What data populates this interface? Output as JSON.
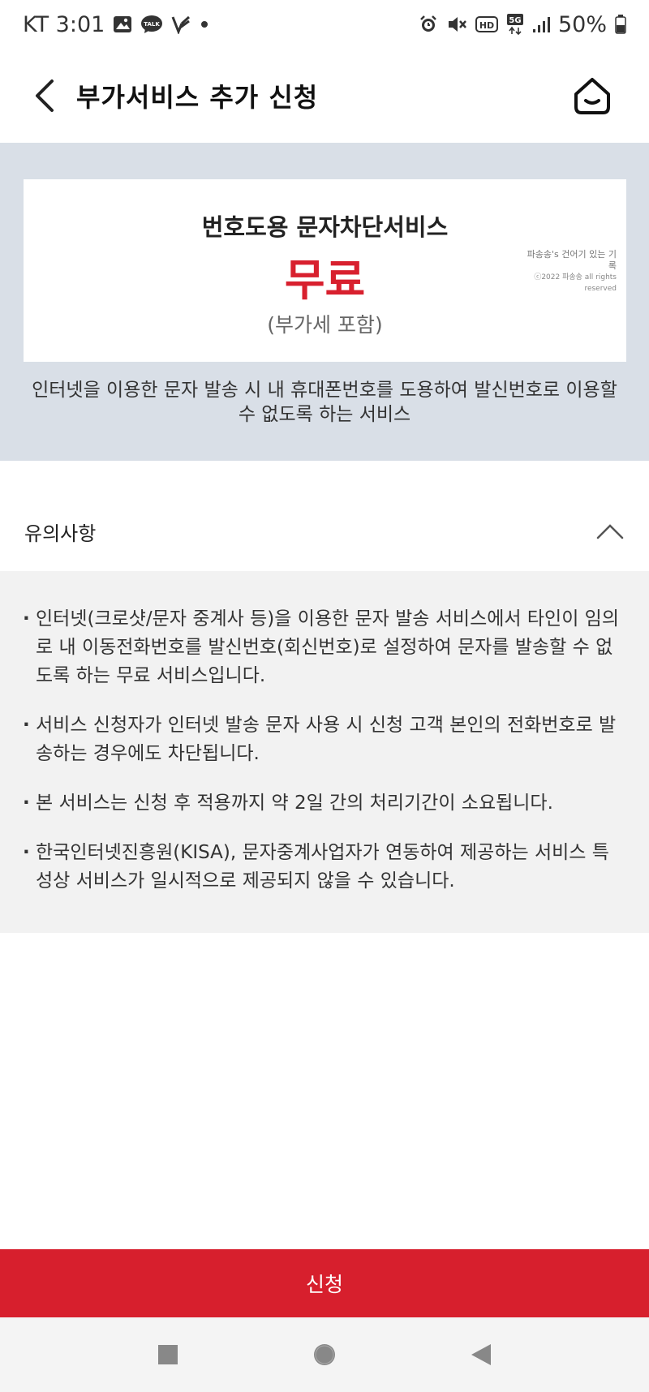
{
  "status_bar": {
    "carrier_time": "KT 3:01",
    "talk_badge": "TALK",
    "battery": "50%",
    "network": "5G",
    "hd": "HD",
    "icons": [
      "gallery-icon",
      "talk-icon",
      "v-icon",
      "dot-icon",
      "alarm-icon",
      "mute-icon",
      "hd-icon",
      "5g-icon",
      "signal-icon",
      "battery-icon"
    ]
  },
  "app_bar": {
    "title": "부가서비스 추가 신청",
    "back_icon": "chevron-left-icon",
    "home_icon": "home-icon"
  },
  "service": {
    "name": "번호도용 문자차단서비스",
    "price": "무료",
    "vat_note": "(부가세 포함)",
    "description": "인터넷을 이용한 문자 발송 시 내 휴대폰번호를 도용하여 발신번호로 이용할 수 없도록 하는 서비스"
  },
  "watermark": {
    "line1": "파송송's 건어기 있는 기록",
    "line2": "ⓒ2022 파송송 all rights reserved"
  },
  "notice": {
    "title": "유의사항",
    "expanded": true,
    "items": [
      "인터넷(크로샷/문자 중계사 등)을 이용한 문자 발송 서비스에서 타인이 임의로 내 이동전화번호를 발신번호(회신번호)로 설정하여 문자를 발송할 수 없도록 하는 무료 서비스입니다.",
      "서비스 신청자가 인터넷 발송 문자 사용 시 신청 고객 본인의 전화번호로 발송하는 경우에도 차단됩니다.",
      "본 서비스는 신청 후 적용까지 약 2일 간의 처리기간이 소요됩니다.",
      "한국인터넷진흥원(KISA), 문자중계사업자가 연동하여 제공하는 서비스 특성상 서비스가 일시적으로 제공되지 않을 수 있습니다."
    ]
  },
  "apply_button": {
    "label": "신청"
  },
  "colors": {
    "accent": "#d71f2d",
    "hero_bg": "#d9dfe7",
    "notice_bg": "#f2f2f2"
  }
}
